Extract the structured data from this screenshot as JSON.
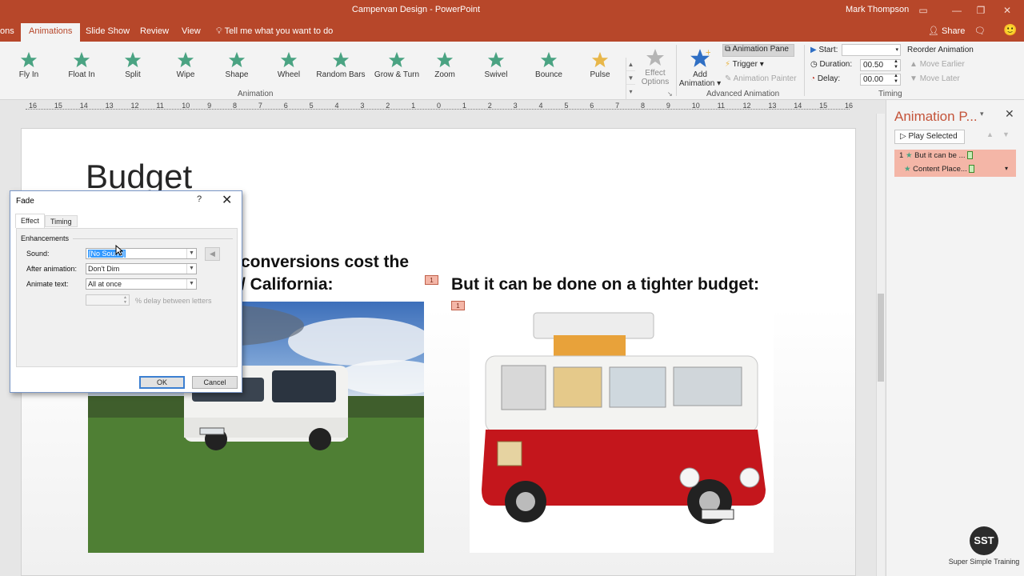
{
  "window": {
    "title": "Campervan Design - PowerPoint",
    "user": "Mark Thompson"
  },
  "tabs": {
    "prev_cut": "ons",
    "active": "Animations",
    "items": [
      "Slide Show",
      "Review",
      "View"
    ],
    "tell_me": "Tell me what you want to do",
    "share": "Share"
  },
  "ribbon": {
    "animations": [
      "Fly In",
      "Float In",
      "Split",
      "Wipe",
      "Shape",
      "Wheel",
      "Random Bars",
      "Grow & Turn",
      "Zoom",
      "Swivel",
      "Bounce",
      "Pulse"
    ],
    "effect_options": [
      "Effect",
      "Options"
    ],
    "group_animation": "Animation",
    "add_animation": [
      "Add",
      "Animation"
    ],
    "animation_pane": "Animation Pane",
    "trigger": "Trigger",
    "animation_painter": "Animation Painter",
    "group_advanced": "Advanced Animation",
    "start_label": "Start:",
    "start_value": "",
    "duration_label": "Duration:",
    "duration_value": "00.50",
    "delay_label": "Delay:",
    "delay_value": "00.00",
    "reorder": "Reorder Animation",
    "move_earlier": "Move Earlier",
    "move_later": "Move Later",
    "group_timing": "Timing",
    "colors": {
      "accent": "#b7472a",
      "star_green": "#4aa382",
      "pulse_gold": "#e8b74a"
    }
  },
  "ruler": [
    "16",
    "15",
    "14",
    "13",
    "12",
    "11",
    "10",
    "9",
    "8",
    "7",
    "6",
    "5",
    "4",
    "3",
    "2",
    "1",
    "0",
    "1",
    "2",
    "3",
    "4",
    "5",
    "6",
    "7",
    "8",
    "9",
    "10",
    "11",
    "12",
    "13",
    "14",
    "15",
    "16"
  ],
  "slide": {
    "title": "Budget",
    "left_heading_line1": "conversions cost the",
    "left_heading_line2": "/ California:",
    "right_heading": "But it can be done on a tighter budget:",
    "tag1": "1",
    "tag2": "1"
  },
  "pane": {
    "title": "Animation P...",
    "play_selected": "Play Selected",
    "items": [
      {
        "num": "1",
        "label": "But it can be ..."
      },
      {
        "num": "",
        "label": "Content Place..."
      }
    ]
  },
  "dialog": {
    "title": "Fade",
    "help": "?",
    "tab_effect": "Effect",
    "tab_timing": "Timing",
    "section": "Enhancements",
    "sound_label": "Sound:",
    "sound_value": "[No Sound]",
    "after_label": "After animation:",
    "after_value": "Don't Dim",
    "animate_label": "Animate text:",
    "animate_value": "All at once",
    "delay_text": "% delay between letters",
    "ok": "OK",
    "cancel": "Cancel"
  },
  "branding": {
    "logo": "SST",
    "text": "Super Simple Training"
  }
}
